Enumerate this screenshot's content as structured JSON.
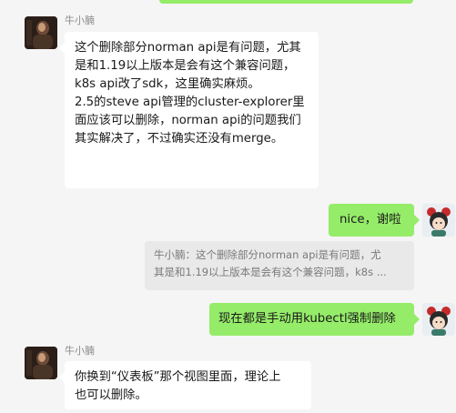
{
  "messages": [
    {
      "sender": "牛小腩",
      "side": "left",
      "text": "这个删除部分norman api是有问题，尤其\n是和1.19以上版本是会有这个兼容问题，\nk8s api改了sdk，这里确实麻烦。\n2.5的steve api管理的cluster-explorer里\n面应该可以删除，norman api的问题我们\n其实解决了，不过确实还没有merge。"
    },
    {
      "side": "right",
      "text": "nice，谢啦",
      "quote": "牛小腩：这个删除部分norman api是有问题，尤\n其是和1.19以上版本是会有这个兼容问题，k8s ..."
    },
    {
      "side": "right",
      "text": "现在都是手动用kubectl强制删除"
    },
    {
      "sender": "牛小腩",
      "side": "left",
      "text": "你换到“仪表板”那个视图里面，理论上\n也可以删除。"
    }
  ],
  "colors": {
    "background": "#f5f5f5",
    "bubble_self": "#95ec69",
    "bubble_other": "#ffffff",
    "quote_bg": "#e9e9e9"
  }
}
